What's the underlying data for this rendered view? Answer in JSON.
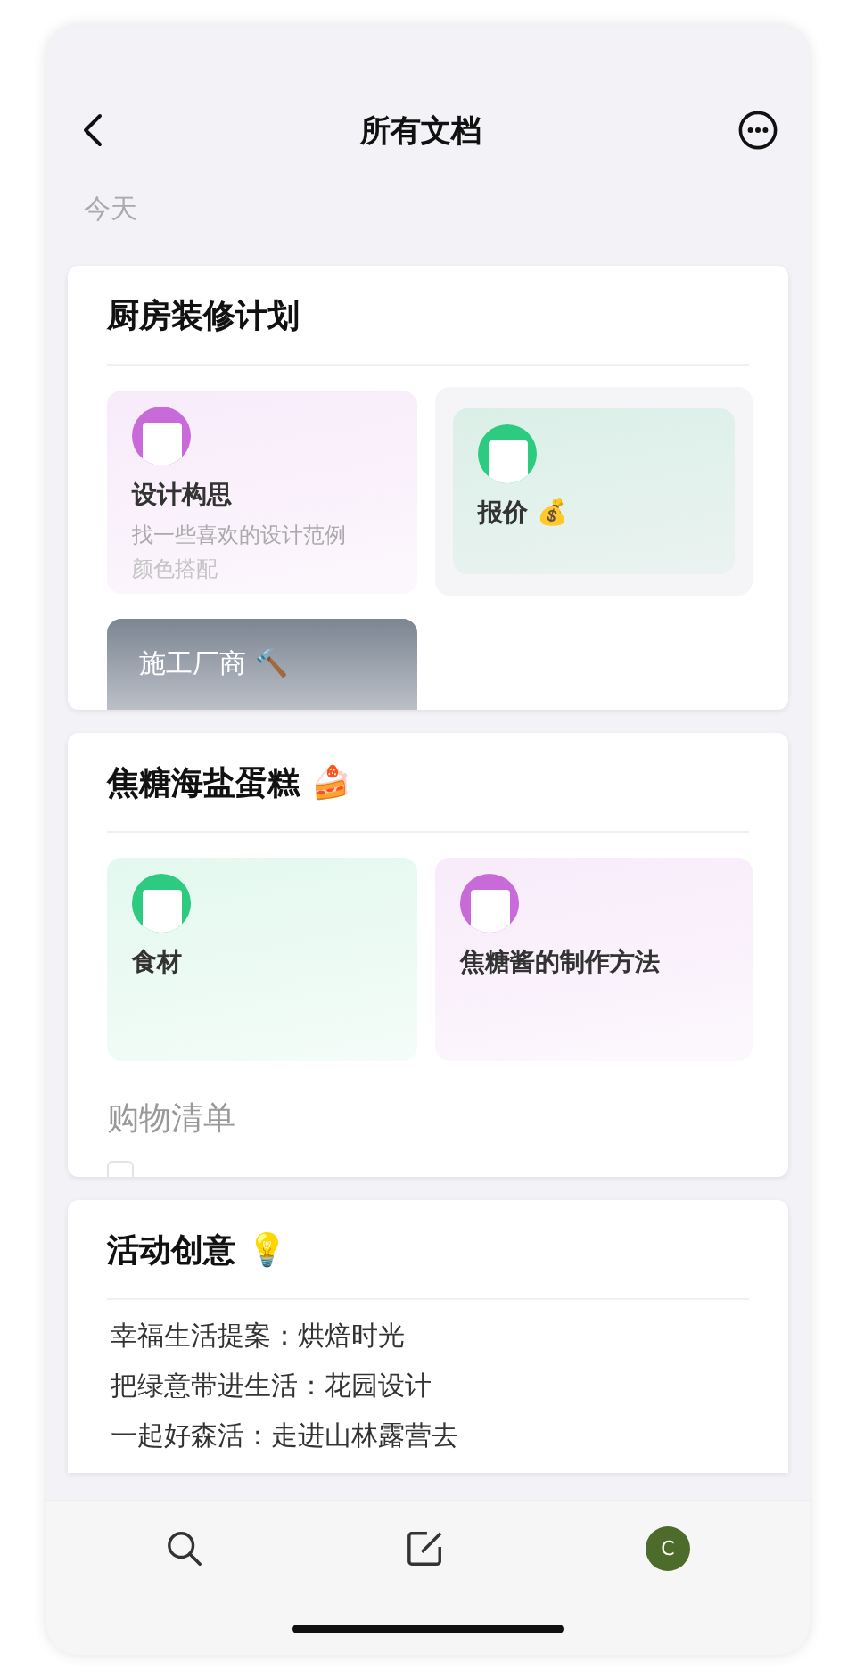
{
  "nav": {
    "title": "所有文档"
  },
  "section_label": "今天",
  "notebooks": [
    {
      "title": "厨房装修计划",
      "blocks": [
        {
          "kind": "tiles",
          "tiles": [
            {
              "kind": "doc",
              "color": "#c86ad8",
              "title": "设计构思",
              "lines": [
                "找一些喜欢的设计范例",
                "颜色搭配"
              ],
              "selected": false
            },
            {
              "kind": "doc",
              "color": "#2ccb80",
              "title": "报价 💰",
              "selected": true
            },
            {
              "kind": "cover",
              "title": "施工厂商 🔨",
              "selected": false
            }
          ]
        }
      ]
    },
    {
      "title": "焦糖海盐蛋糕 🍰",
      "blocks": [
        {
          "kind": "tiles",
          "tiles": [
            {
              "kind": "doc",
              "color": "#2ccb80",
              "title": "食材",
              "selected": false
            },
            {
              "kind": "doc",
              "color": "#c86ad8",
              "title": "焦糖酱的制作方法",
              "selected": false
            }
          ]
        },
        {
          "kind": "checklist",
          "title": "购物清单",
          "checked": false
        }
      ]
    },
    {
      "title": "活动创意 💡",
      "blocks": [
        {
          "kind": "text",
          "lines": [
            "幸福生活提案：烘焙时光",
            "把绿意带进生活：花园设计",
            "一起好森活：走进山林露营去"
          ]
        }
      ]
    }
  ],
  "tab_bar": {
    "avatar": "C"
  }
}
